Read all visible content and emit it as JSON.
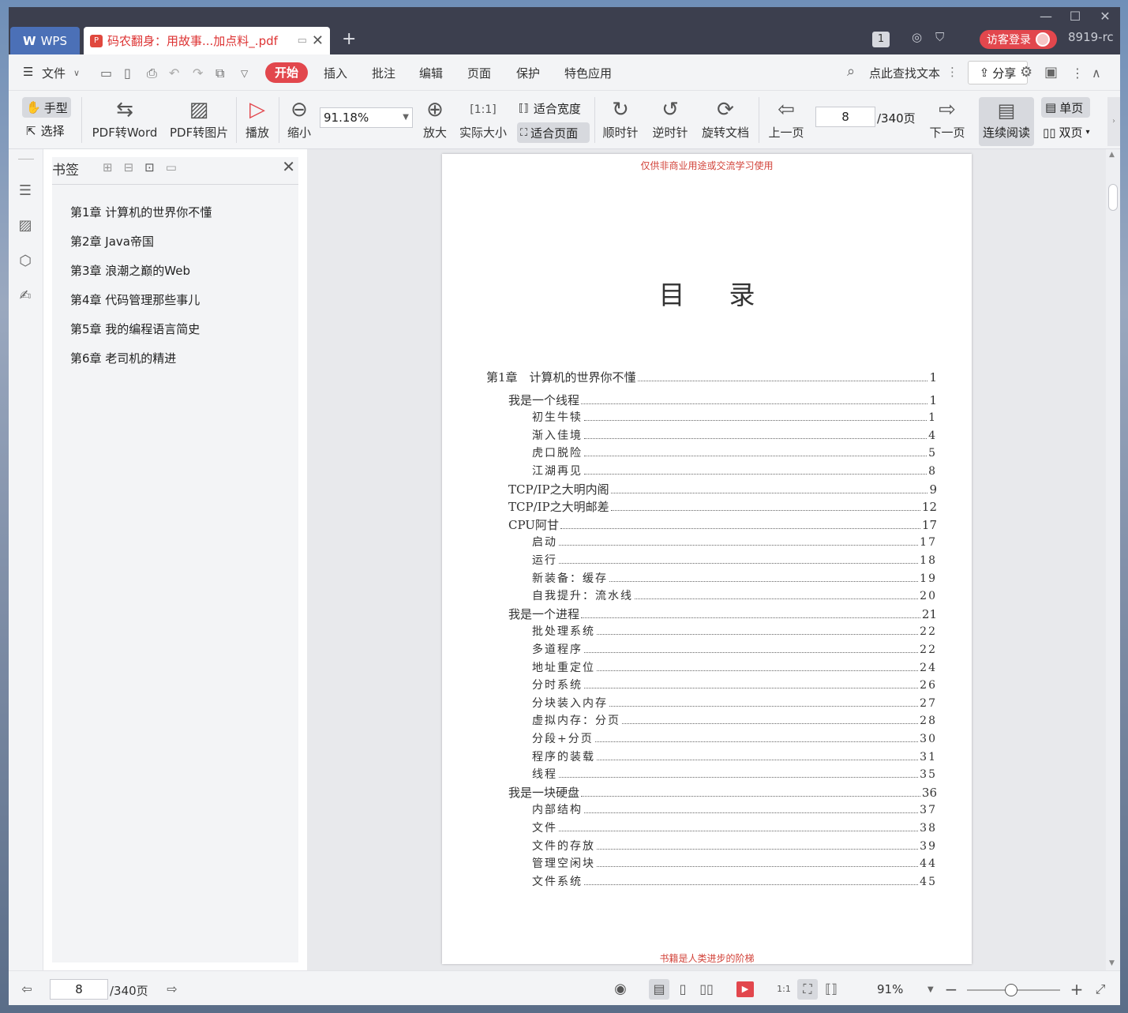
{
  "app": {
    "wps_label": "WPS",
    "doc_tab": "码农翻身：用故事...加点料_.pdf",
    "new_tab": "+",
    "window_controls": [
      "—",
      "☐",
      "✕"
    ],
    "page_badge": "1",
    "login": "访客登录",
    "user": "8919-rc"
  },
  "menu": {
    "file": "文件",
    "start": "开始",
    "items": [
      "插入",
      "批注",
      "编辑",
      "页面",
      "保护",
      "特色应用"
    ],
    "search": "点此查找文本",
    "share": "分享"
  },
  "toolbar": {
    "hand": "手型",
    "select": "选择",
    "pdf2word": "PDF转Word",
    "pdf2img": "PDF转图片",
    "play": "播放",
    "zoom_out": "缩小",
    "zoom_value": "91.18%",
    "zoom_in": "放大",
    "actual_size": "实际大小",
    "fit_width": "适合宽度",
    "fit_page": "适合页面",
    "cw": "顺时针",
    "ccw": "逆时针",
    "rotate": "旋转文档",
    "prev": "上一页",
    "page": "8",
    "page_total": "/340页",
    "next": "下一页",
    "continuous": "连续阅读",
    "single": "单页",
    "double": "双页"
  },
  "bookmarks": {
    "title": "书签",
    "items": [
      "第1章 计算机的世界你不懂",
      "第2章 Java帝国",
      "第3章 浪潮之巅的Web",
      "第4章 代码管理那些事儿",
      "第5章 我的编程语言简史",
      "第6章 老司机的精进"
    ]
  },
  "page_content": {
    "watermark_top": "仅供非商业用途或交流学习使用",
    "heading": "目录",
    "watermark_bottom": "书籍是人类进步的阶梯",
    "toc": [
      {
        "text": "第1章　计算机的世界你不懂",
        "page": "1",
        "level": 0
      },
      {
        "text": "我是一个线程",
        "page": "1",
        "level": 1
      },
      {
        "text": "初生牛犊",
        "page": "1",
        "level": 2
      },
      {
        "text": "渐入佳境",
        "page": "4",
        "level": 2
      },
      {
        "text": "虎口脱险",
        "page": "5",
        "level": 2
      },
      {
        "text": "江湖再见",
        "page": "8",
        "level": 2
      },
      {
        "text": "TCP/IP之大明内阁",
        "page": "9",
        "level": 1
      },
      {
        "text": "TCP/IP之大明邮差",
        "page": "12",
        "level": 1
      },
      {
        "text": "CPU阿甘",
        "page": "17",
        "level": 1
      },
      {
        "text": "启动",
        "page": "17",
        "level": 2
      },
      {
        "text": "运行",
        "page": "18",
        "level": 2
      },
      {
        "text": "新装备：缓存",
        "page": "19",
        "level": 2
      },
      {
        "text": "自我提升：流水线",
        "page": "20",
        "level": 2
      },
      {
        "text": "我是一个进程",
        "page": "21",
        "level": 1
      },
      {
        "text": "批处理系统",
        "page": "22",
        "level": 2
      },
      {
        "text": "多道程序",
        "page": "22",
        "level": 2
      },
      {
        "text": "地址重定位",
        "page": "24",
        "level": 2
      },
      {
        "text": "分时系统",
        "page": "26",
        "level": 2
      },
      {
        "text": "分块装入内存",
        "page": "27",
        "level": 2
      },
      {
        "text": "虚拟内存：分页",
        "page": "28",
        "level": 2
      },
      {
        "text": "分段+分页",
        "page": "30",
        "level": 2
      },
      {
        "text": "程序的装载",
        "page": "31",
        "level": 2
      },
      {
        "text": "线程",
        "page": "35",
        "level": 2
      },
      {
        "text": "我是一块硬盘",
        "page": "36",
        "level": 1
      },
      {
        "text": "内部结构",
        "page": "37",
        "level": 2
      },
      {
        "text": "文件",
        "page": "38",
        "level": 2
      },
      {
        "text": "文件的存放",
        "page": "39",
        "level": 2
      },
      {
        "text": "管理空闲块",
        "page": "44",
        "level": 2
      },
      {
        "text": "文件系统",
        "page": "45",
        "level": 2
      }
    ]
  },
  "status": {
    "page": "8",
    "page_total": "/340页",
    "zoom": "91%",
    "zoom_fraction": 0.41
  }
}
